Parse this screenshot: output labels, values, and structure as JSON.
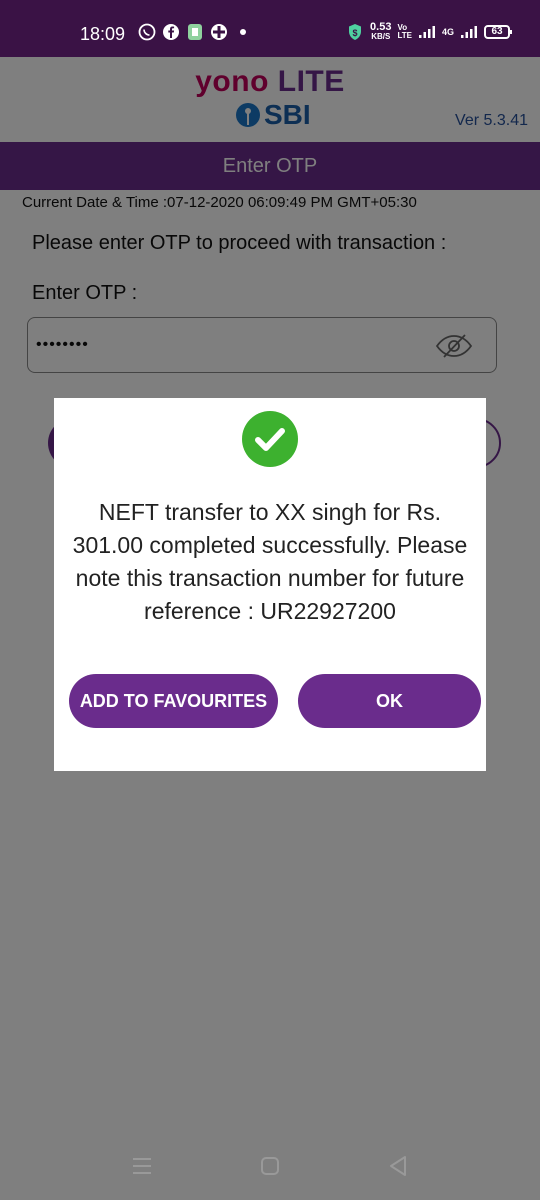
{
  "status_bar": {
    "time": "18:09",
    "speed_value": "0.53",
    "speed_unit": "KB/S",
    "volte": "Vo\nLTE",
    "network": "4G",
    "battery": "63"
  },
  "header": {
    "brand_yono": "yono",
    "brand_lite": "LITE",
    "brand_sbi": "SBI",
    "version": "Ver 5.3.41"
  },
  "page": {
    "title": "Enter OTP",
    "datetime": "Current Date & Time :07-12-2020 06:09:49 PM GMT+05:30",
    "prompt": "Please enter OTP to proceed with transaction :",
    "otp_label": "Enter OTP :",
    "otp_value": "••••••••"
  },
  "dialog": {
    "message": "NEFT transfer to XX singh for Rs. 301.00 completed successfully. Please note this transaction number for future reference : UR22927200",
    "add_favourites_label": "ADD TO FAVOURITES",
    "ok_label": "OK"
  },
  "colors": {
    "brand_purple": "#6a2c8c",
    "status_bar": "#3a1245",
    "success_green": "#3db12f",
    "yono_magenta": "#c0005a",
    "sbi_blue": "#1a5fa8"
  },
  "icons": [
    "whatsapp-icon",
    "facebook-icon",
    "app-icon",
    "game-icon",
    "dot-icon",
    "shield-icon",
    "signal-icon",
    "battery-icon",
    "eye-slash-icon",
    "check-icon",
    "recent-apps-icon",
    "home-icon",
    "back-icon"
  ]
}
